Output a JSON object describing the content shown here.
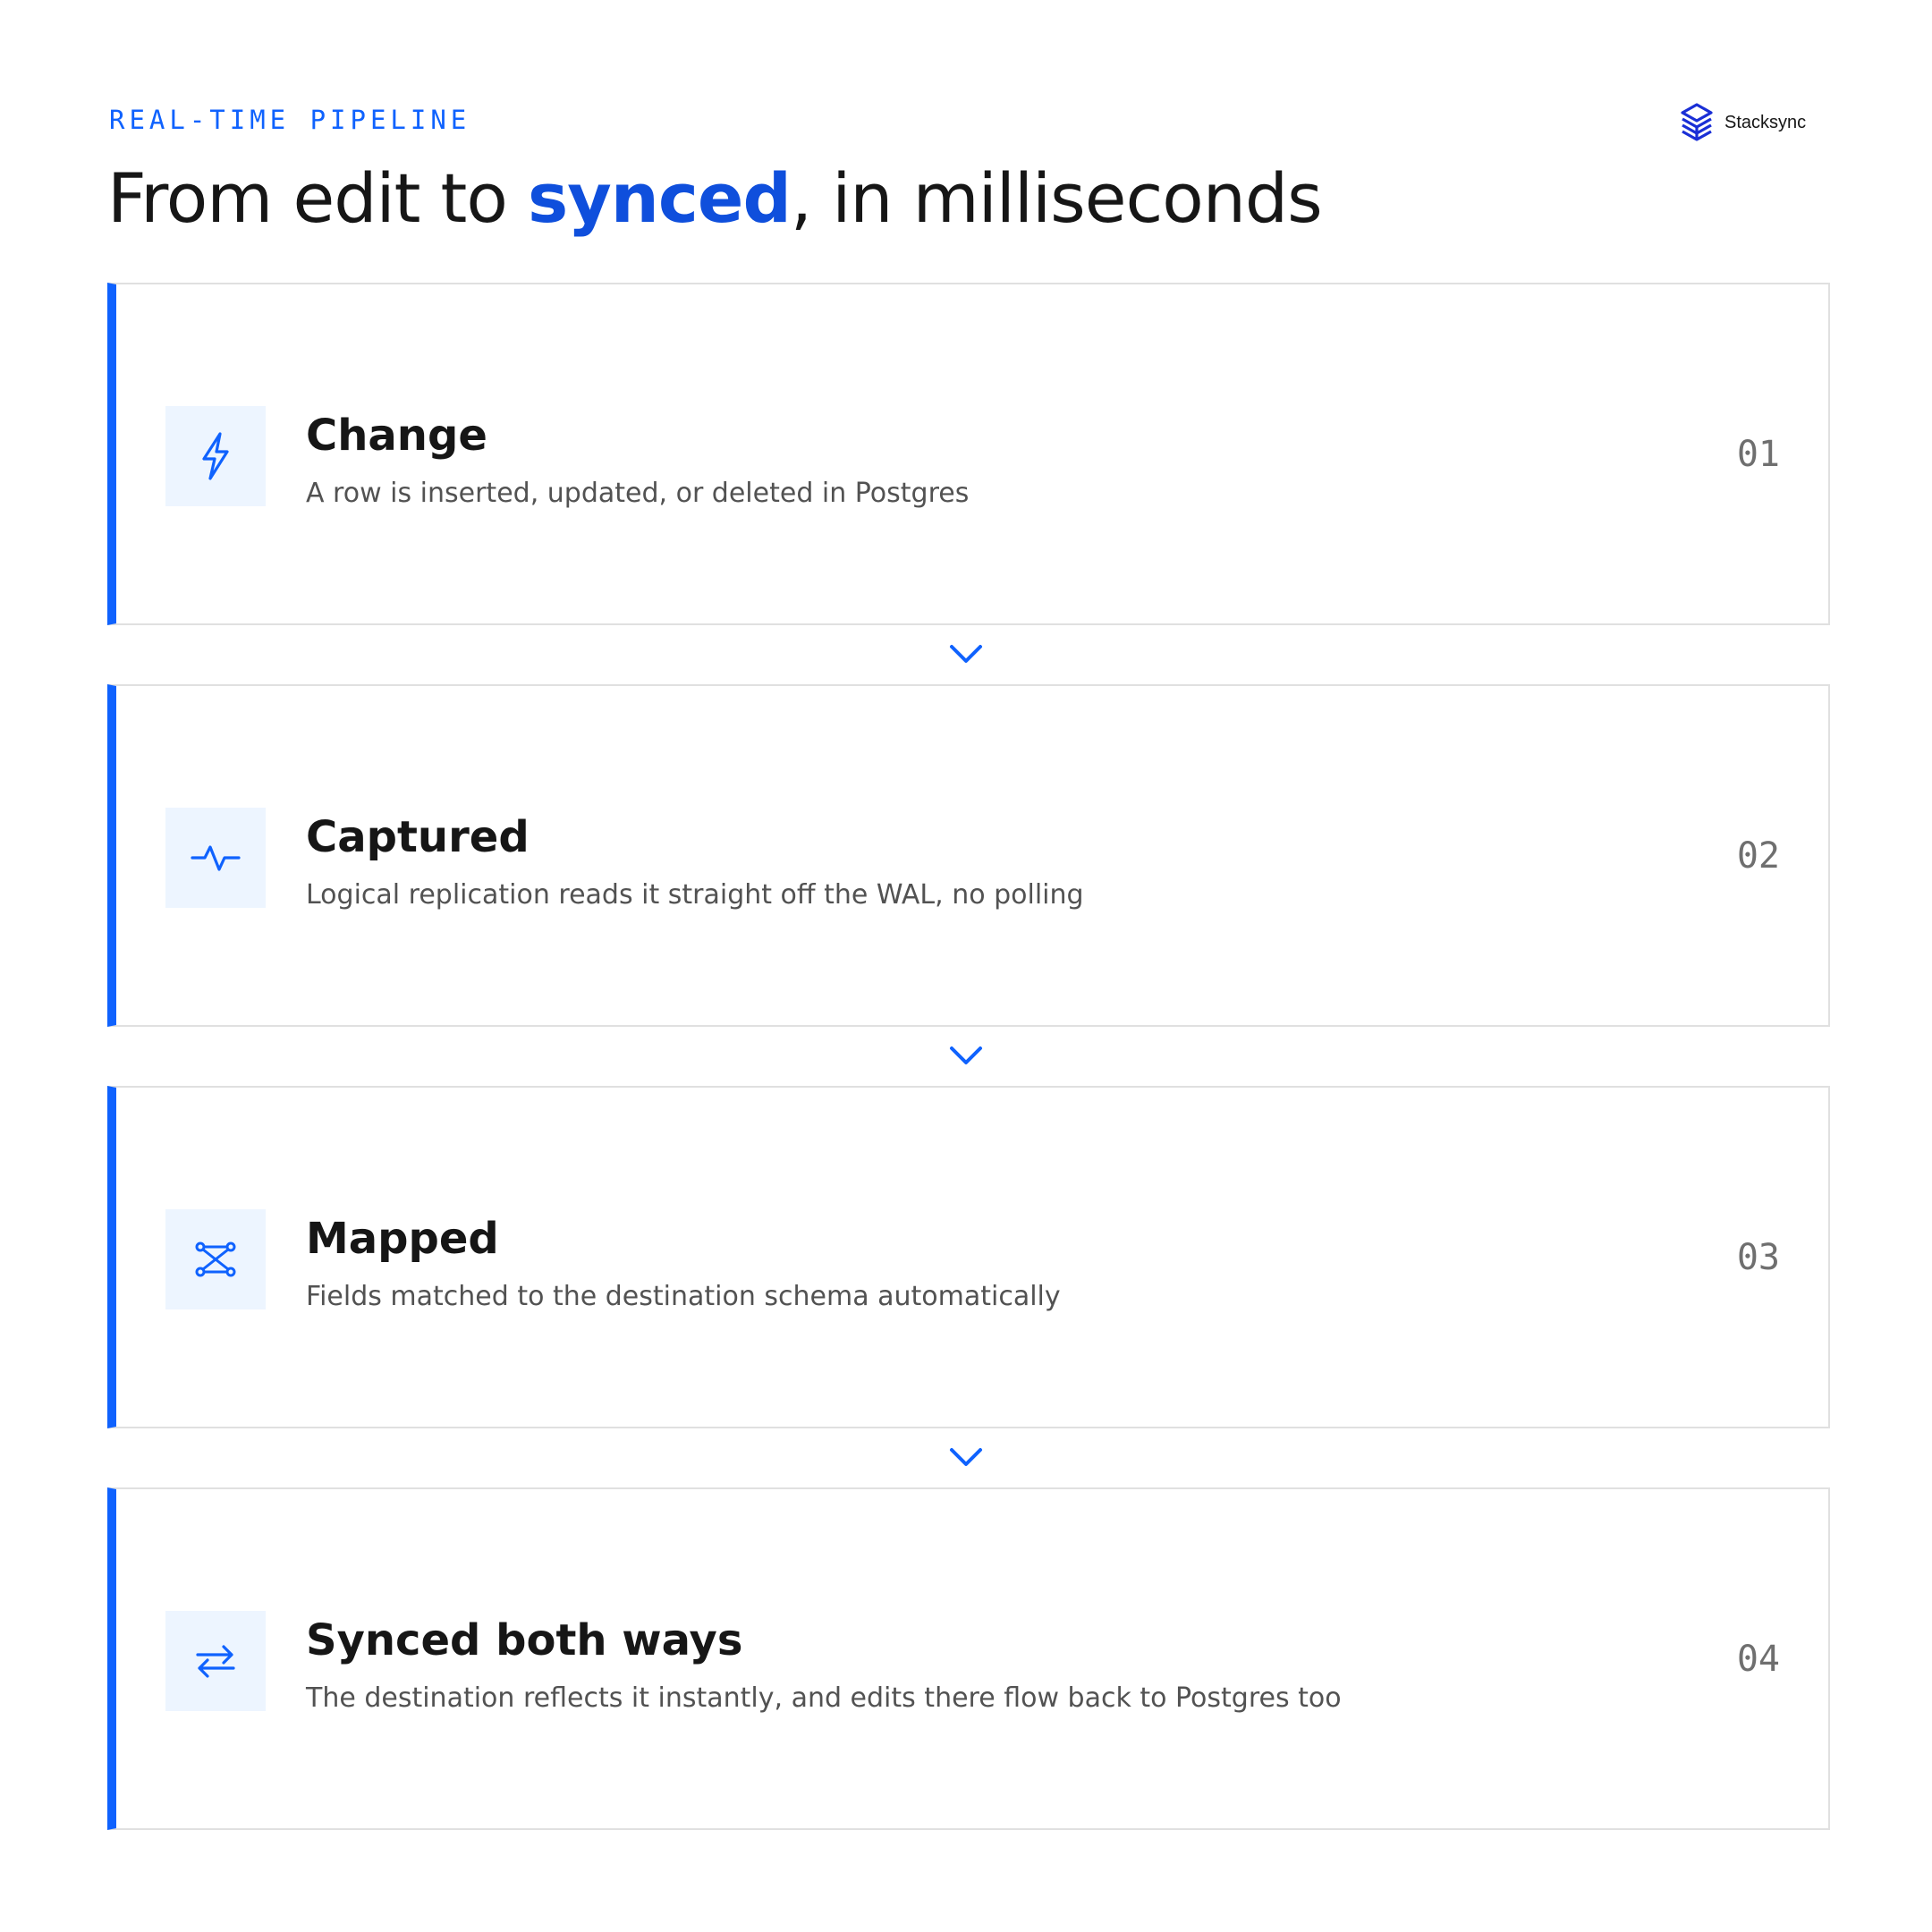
{
  "header": {
    "eyebrow": "REAL-TIME PIPELINE",
    "title_prefix": "From edit to ",
    "title_accent": "synced",
    "title_suffix": ", in milliseconds"
  },
  "brand": {
    "name": "Stacksync",
    "icon": "stacksync-logo-icon"
  },
  "colors": {
    "accent": "#0f62fe",
    "accent_text": "#0f4fdc",
    "icon_bg": "#edf5ff",
    "border": "#e0e0e0"
  },
  "steps": [
    {
      "number": "01",
      "title": "Change",
      "description": "A row is inserted, updated, or deleted in Postgres",
      "icon": "lightning-bolt-icon"
    },
    {
      "number": "02",
      "title": "Captured",
      "description": "Logical replication reads it straight off the WAL, no polling",
      "icon": "pulse-activity-icon"
    },
    {
      "number": "03",
      "title": "Mapped",
      "description": "Fields matched to the destination schema automatically",
      "icon": "field-mapping-icon"
    },
    {
      "number": "04",
      "title": "Synced both ways",
      "description": "The destination reflects it instantly, and edits there flow back to Postgres too",
      "icon": "bidirectional-arrows-icon"
    }
  ]
}
